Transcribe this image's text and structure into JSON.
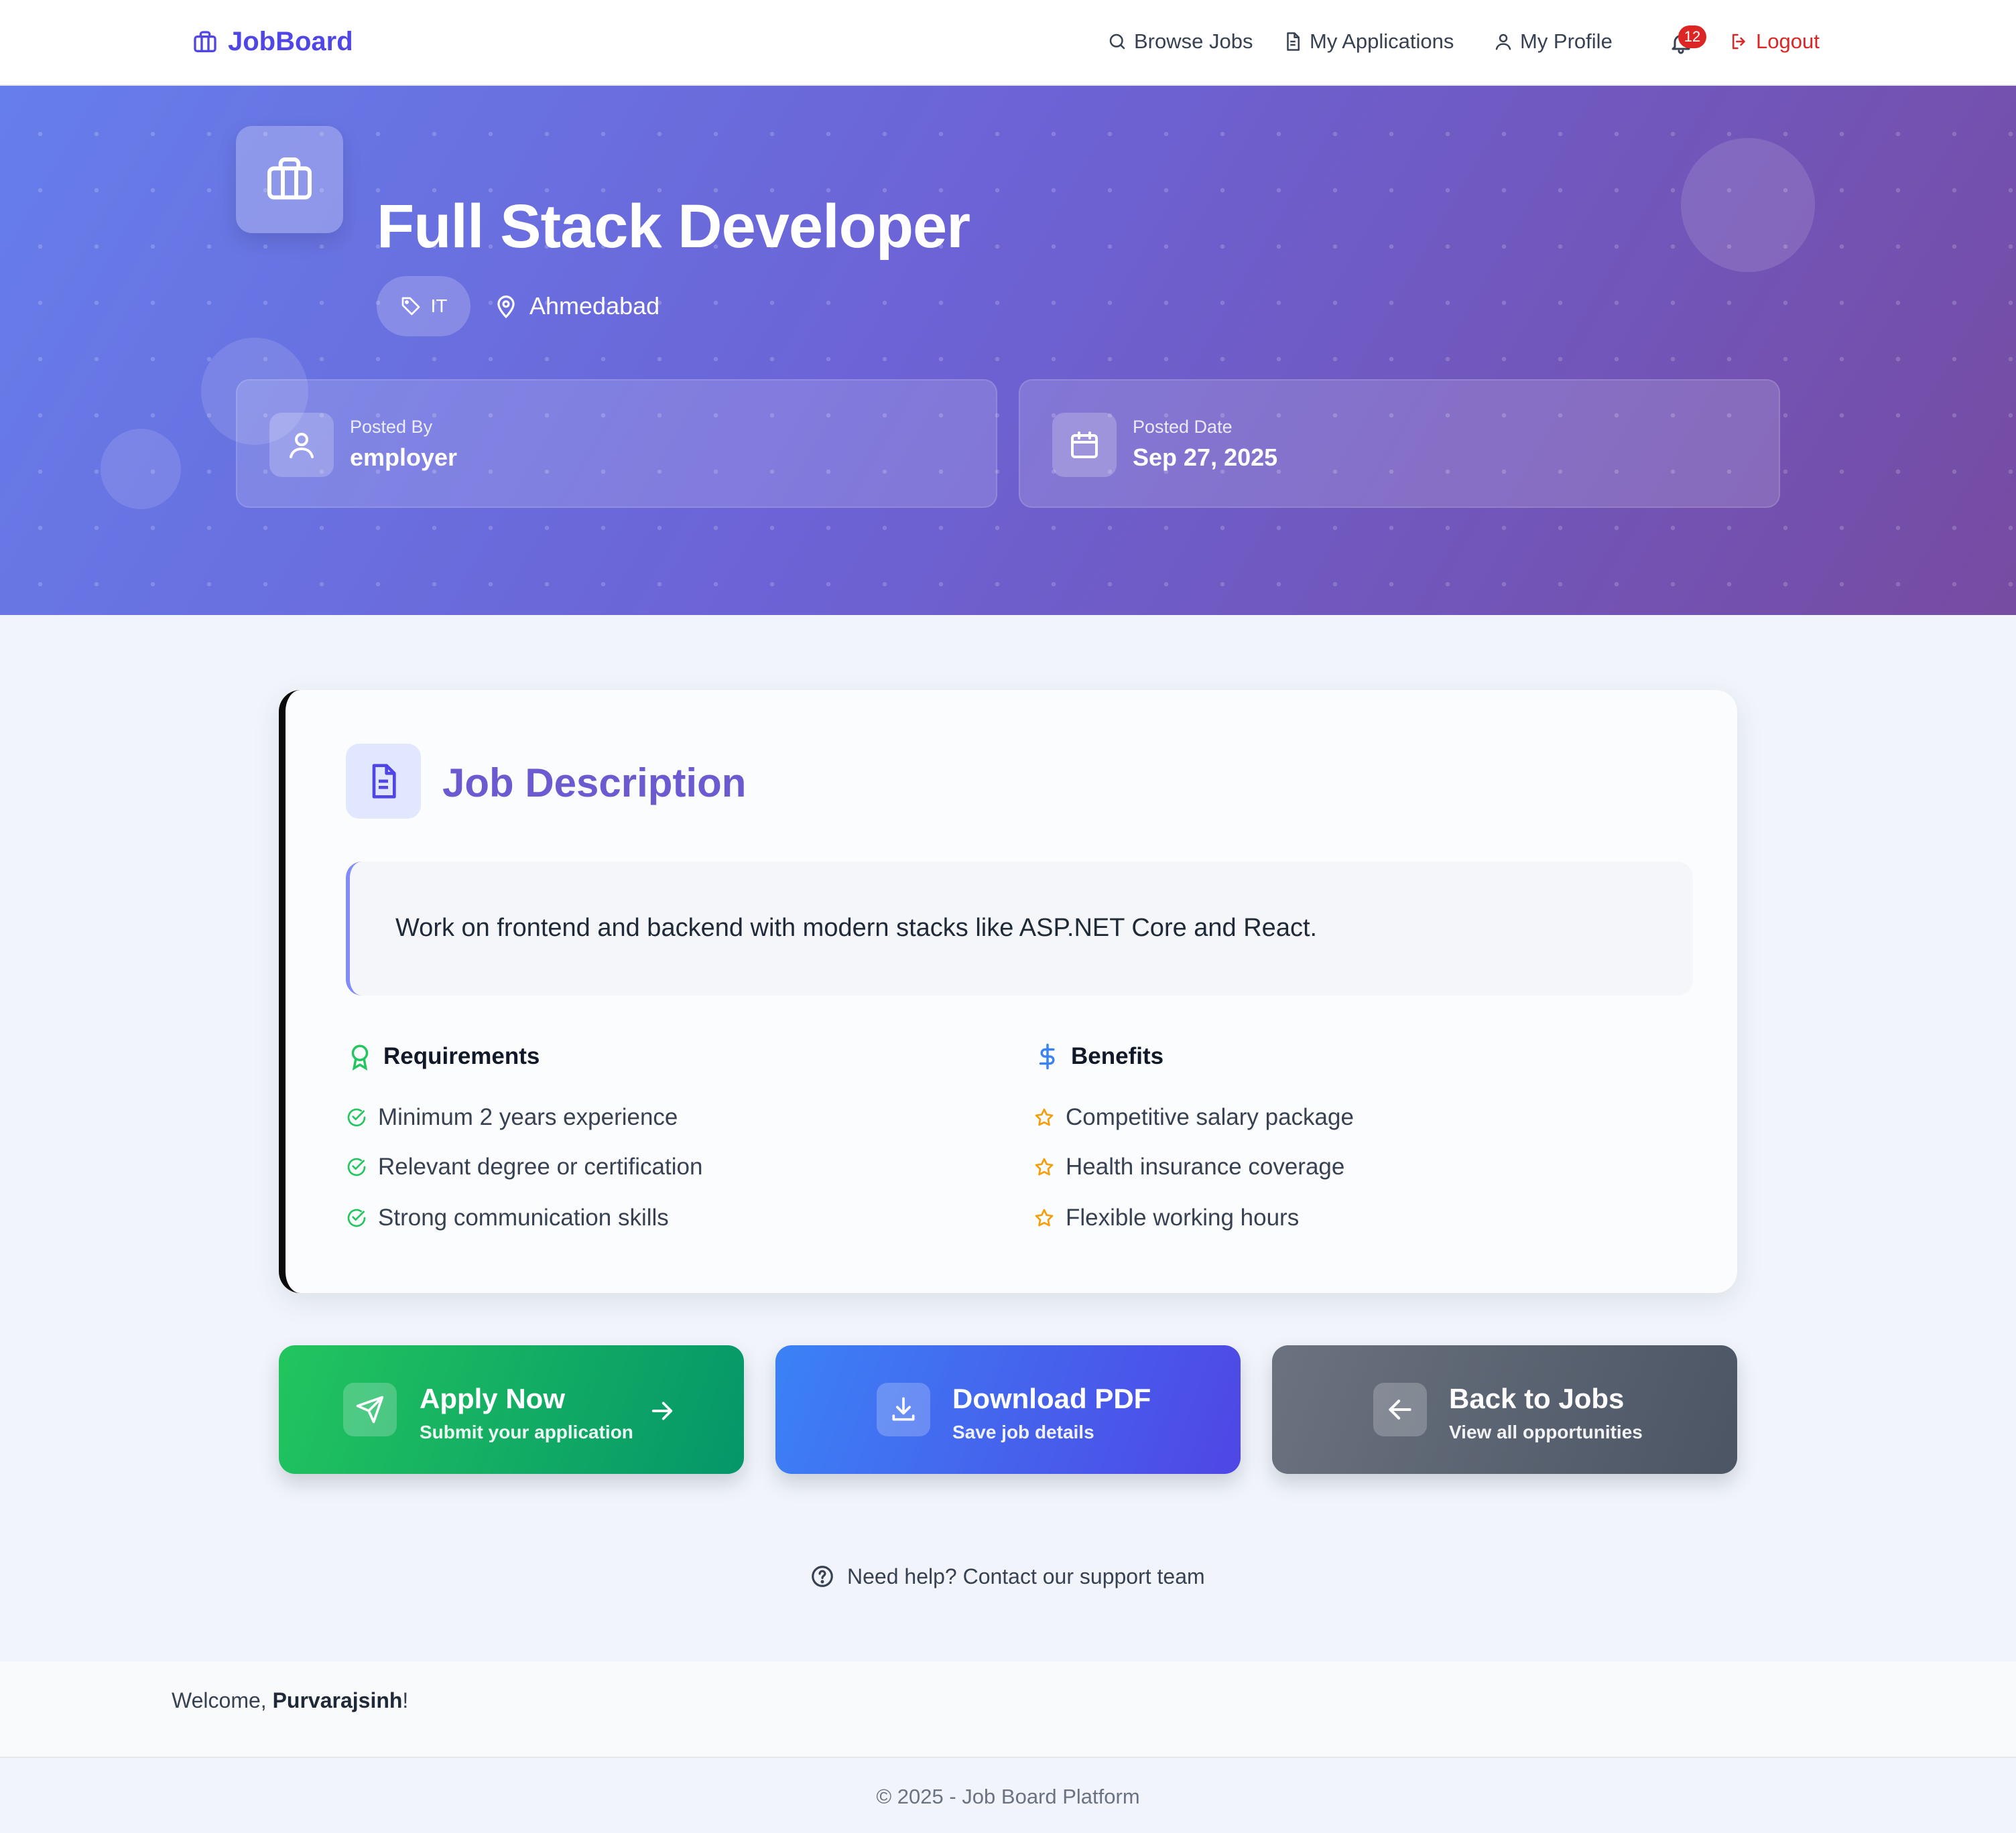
{
  "navbar": {
    "brand": "JobBoard",
    "links": [
      {
        "label": "Browse Jobs",
        "icon": "search-icon"
      },
      {
        "label": "My Applications",
        "icon": "document-icon"
      },
      {
        "label": "My Profile",
        "icon": "user-icon"
      }
    ],
    "notification_count": "12",
    "logout_label": "Logout"
  },
  "hero": {
    "title": "Full Stack Developer",
    "category": "IT",
    "location": "Ahmedabad",
    "posted_by_label": "Posted By",
    "posted_by_value": "employer",
    "posted_date_label": "Posted Date",
    "posted_date_value": "Sep 27, 2025"
  },
  "description": {
    "title": "Job Description",
    "text": "Work on frontend and backend with modern stacks like ASP.NET Core and React.",
    "requirements_title": "Requirements",
    "requirements": [
      "Minimum 2 years experience",
      "Relevant degree or certification",
      "Strong communication skills"
    ],
    "benefits_title": "Benefits",
    "benefits": [
      "Competitive salary package",
      "Health insurance coverage",
      "Flexible working hours"
    ]
  },
  "actions": {
    "apply": {
      "title": "Apply Now",
      "subtitle": "Submit your application"
    },
    "download": {
      "title": "Download PDF",
      "subtitle": "Save job details"
    },
    "back": {
      "title": "Back to Jobs",
      "subtitle": "View all opportunities"
    }
  },
  "help_text": "Need help? Contact our support team",
  "footer": {
    "welcome_prefix": "Welcome, ",
    "username": "Purvarajsinh",
    "welcome_suffix": "!",
    "copyright": "© 2025 - Job Board Platform"
  },
  "colors": {
    "brand": "#4f46e5",
    "hero_gradient_start": "#667eea",
    "hero_gradient_end": "#764ba2",
    "apply_green": "#22c55e",
    "download_blue": "#3b82f6",
    "back_gray": "#6b7280",
    "logout_red": "#dc2626"
  }
}
